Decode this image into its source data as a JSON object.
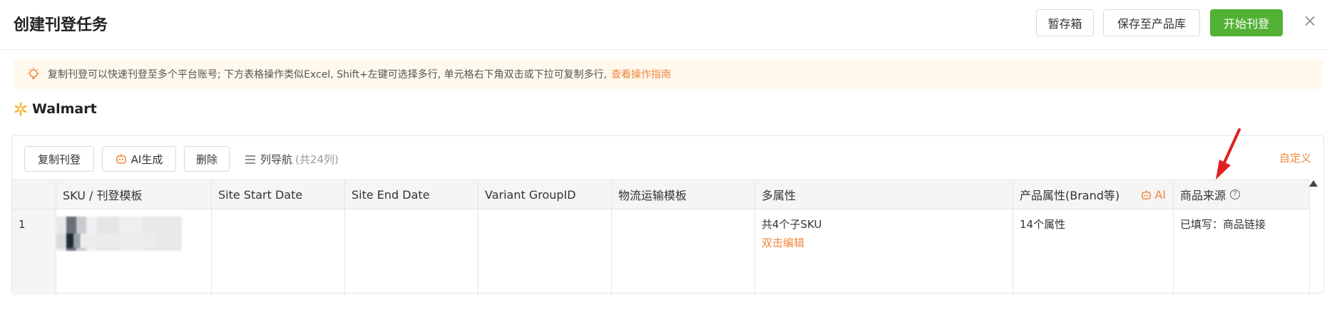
{
  "header": {
    "title": "创建刊登任务",
    "draft_label": "暂存箱",
    "save_label": "保存至产品库",
    "start_label": "开始刊登",
    "close_glyph": "×"
  },
  "tip": {
    "text": "复制刊登可以快速刊登至多个平台账号; 下方表格操作类似Excel, Shift+左键可选择多行, 单元格右下角双击或下拉可复制多行,",
    "link": "查看操作指南"
  },
  "platform": {
    "name": "Walmart"
  },
  "toolbar": {
    "copy_label": "复制刊登",
    "ai_label": "AI生成",
    "delete_label": "删除",
    "colnav_label": "列导航",
    "colnav_count": "(共24列)",
    "custom_label": "自定义"
  },
  "table": {
    "headers": {
      "sku": "SKU / 刊登模板",
      "start": "Site Start Date",
      "end": "Site End Date",
      "variant": "Variant GroupID",
      "logistics": "物流运输模板",
      "multi": "多属性",
      "product": "产品属性(Brand等)",
      "ai": "AI",
      "source": "商品来源",
      "help_glyph": "?"
    },
    "rows": [
      {
        "num": "1",
        "multi_count": "共4个子SKU",
        "multi_edit": "双击编辑",
        "product": "14个属性",
        "source": "已填写：商品链接"
      }
    ]
  },
  "colors": {
    "primary": "#52b135",
    "accent": "#f0883e",
    "tip_bg": "#fff8ec"
  }
}
